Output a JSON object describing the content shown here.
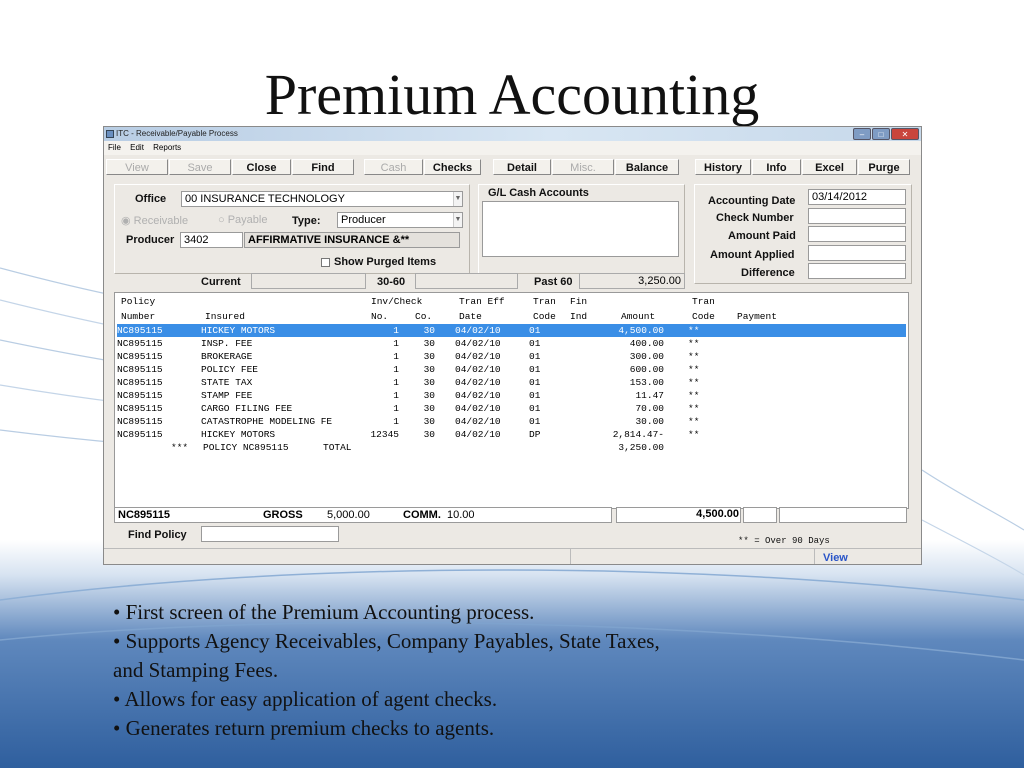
{
  "slide": {
    "title": "Premium Accounting",
    "bullets": [
      "• First screen of the Premium Accounting process.",
      "• Supports Agency Receivables, Company Payables, State Taxes,",
      "and Stamping Fees.",
      "• Allows for easy application of agent checks.",
      "• Generates return premium checks to agents."
    ]
  },
  "window": {
    "title": "ITC - Receivable/Payable Process",
    "controls": [
      "–",
      "□",
      "✕"
    ],
    "menu": [
      "File",
      "Edit",
      "Reports"
    ]
  },
  "toolbar": {
    "view": "View",
    "save": "Save",
    "close": "Close",
    "find": "Find",
    "cash": "Cash",
    "checks": "Checks",
    "detail": "Detail",
    "misc": "Misc.",
    "balance": "Balance",
    "history": "History",
    "info": "Info",
    "excel": "Excel",
    "purge": "Purge"
  },
  "form": {
    "office_label": "Office",
    "office_value": "00  INSURANCE TECHNOLOGY",
    "receivable_label": "Receivable",
    "payable_label": "Payable",
    "type_label": "Type:",
    "type_value": "Producer",
    "producer_label": "Producer",
    "producer_code": "3402",
    "producer_name": "AFFIRMATIVE INSURANCE &**",
    "show_purged_label": "Show Purged Items",
    "gl_label": "G/L Cash Accounts",
    "accounting_date_label": "Accounting Date",
    "accounting_date_value": "03/14/2012",
    "check_number_label": "Check Number",
    "amount_paid_label": "Amount Paid",
    "amount_applied_label": "Amount Applied",
    "difference_label": "Difference",
    "current_label": "Current",
    "b3060_label": "30-60",
    "past60_label": "Past 60",
    "past60_value": "3,250.00"
  },
  "grid": {
    "headers_top": [
      "Policy",
      "Inv/Check",
      "Tran Eff",
      "Tran",
      "Fin",
      "Tran"
    ],
    "headers_bottom": [
      "Number",
      "Insured",
      "No.",
      "Co.",
      "Date",
      "Code",
      "Ind",
      "Amount",
      "Code",
      "Payment"
    ],
    "rows": [
      {
        "policy": "NC895115",
        "insured": "HICKEY MOTORS",
        "no": "1",
        "co": "30",
        "date": "04/02/10",
        "code": "01",
        "amount": "4,500.00",
        "tcode": "**"
      },
      {
        "policy": "NC895115",
        "insured": "INSP. FEE",
        "no": "1",
        "co": "30",
        "date": "04/02/10",
        "code": "01",
        "amount": "400.00",
        "tcode": "**"
      },
      {
        "policy": "NC895115",
        "insured": "BROKERAGE",
        "no": "1",
        "co": "30",
        "date": "04/02/10",
        "code": "01",
        "amount": "300.00",
        "tcode": "**"
      },
      {
        "policy": "NC895115",
        "insured": "POLICY FEE",
        "no": "1",
        "co": "30",
        "date": "04/02/10",
        "code": "01",
        "amount": "600.00",
        "tcode": "**"
      },
      {
        "policy": "NC895115",
        "insured": "STATE TAX",
        "no": "1",
        "co": "30",
        "date": "04/02/10",
        "code": "01",
        "amount": "153.00",
        "tcode": "**"
      },
      {
        "policy": "NC895115",
        "insured": "STAMP FEE",
        "no": "1",
        "co": "30",
        "date": "04/02/10",
        "code": "01",
        "amount": "11.47",
        "tcode": "**"
      },
      {
        "policy": "NC895115",
        "insured": "CARGO FILING FEE",
        "no": "1",
        "co": "30",
        "date": "04/02/10",
        "code": "01",
        "amount": "70.00",
        "tcode": "**"
      },
      {
        "policy": "NC895115",
        "insured": "CATASTROPHE MODELING FE",
        "no": "1",
        "co": "30",
        "date": "04/02/10",
        "code": "01",
        "amount": "30.00",
        "tcode": "**"
      },
      {
        "policy": "NC895115",
        "insured": "HICKEY MOTORS",
        "no": "12345",
        "co": "30",
        "date": "04/02/10",
        "code": "DP",
        "amount": "2,814.47-",
        "tcode": "**"
      }
    ],
    "total_stars": "***",
    "total_policy": "POLICY NC895115",
    "total_label": "TOTAL",
    "total_amount": "3,250.00"
  },
  "summary": {
    "policy": "NC895115",
    "gross_label": "GROSS",
    "gross_value": "5,000.00",
    "comm_label": "COMM.",
    "comm_value": "10.00",
    "net_value": "4,500.00",
    "find_policy_label": "Find Policy",
    "legend": "** = Over 90 Days",
    "view_link": "View"
  }
}
